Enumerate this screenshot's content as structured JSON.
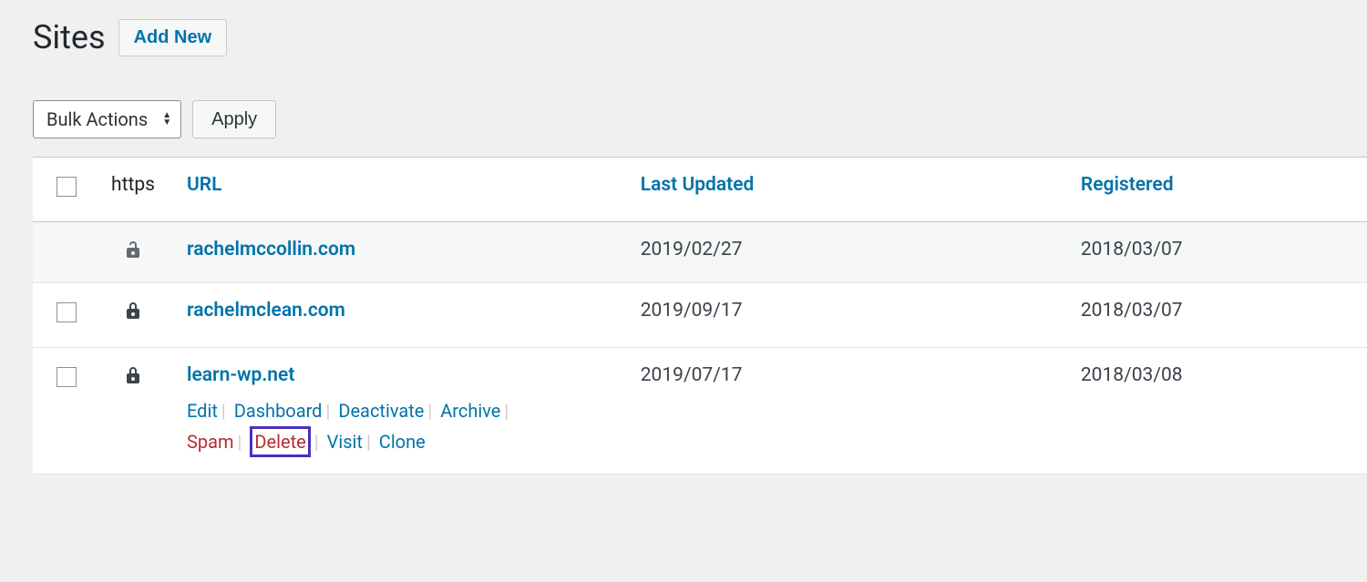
{
  "header": {
    "title": "Sites",
    "add_new": "Add New"
  },
  "tablenav": {
    "bulk_label": "Bulk Actions",
    "apply": "Apply"
  },
  "columns": {
    "https": "https",
    "url": "URL",
    "last_updated": "Last Updated",
    "registered": "Registered"
  },
  "rows": [
    {
      "https_locked": false,
      "show_cb": false,
      "url": "rachelmccollin.com",
      "last_updated": "2019/02/27",
      "registered": "2018/03/07"
    },
    {
      "https_locked": true,
      "show_cb": true,
      "url": "rachelmclean.com",
      "last_updated": "2019/09/17",
      "registered": "2018/03/07"
    },
    {
      "https_locked": true,
      "show_cb": true,
      "url": "learn-wp.net",
      "last_updated": "2019/07/17",
      "registered": "2018/03/08",
      "actions": {
        "edit": "Edit",
        "dashboard": "Dashboard",
        "deactivate": "Deactivate",
        "archive": "Archive",
        "spam": "Spam",
        "delete": "Delete",
        "visit": "Visit",
        "clone": "Clone"
      }
    }
  ]
}
